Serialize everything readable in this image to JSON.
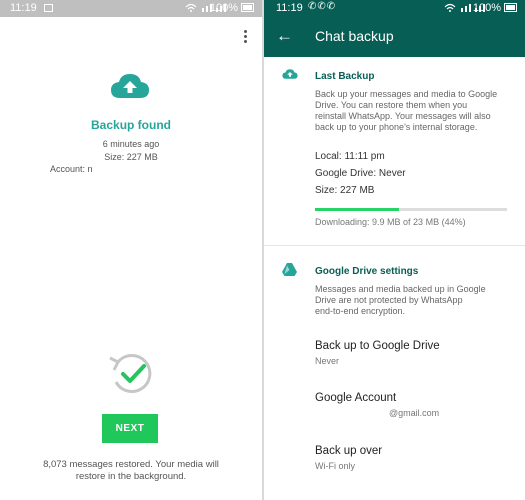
{
  "left_screen": {
    "status": {
      "time": "11:19",
      "battery": "100%"
    },
    "backup_found": "Backup found",
    "backup_age": "6 minutes ago",
    "backup_size": "Size: 227 MB",
    "account_label": "Account: n",
    "next_label": "NEXT",
    "restored_line1": "8,073 messages restored. Your media will",
    "restored_line2": "restore in the background."
  },
  "right_screen": {
    "status": {
      "time": "11:19",
      "battery": "100%"
    },
    "title": "Chat backup",
    "last_backup": {
      "heading": "Last Backup",
      "description": [
        "Back up your messages and media to Google",
        "Drive. You can restore them when you",
        "reinstall WhatsApp. Your messages will also",
        "back up to your phone's internal storage."
      ],
      "local": "Local: 11:11 pm",
      "google_drive": "Google Drive: Never",
      "size": "Size: 227 MB",
      "progress_fraction": 0.44,
      "downloading": "Downloading: 9.9 MB of 23 MB (44%)"
    },
    "drive_settings": {
      "heading": "Google Drive settings",
      "description": [
        "Messages and media backed up in Google",
        "Drive are not protected by WhatsApp",
        "end-to-end encryption."
      ]
    },
    "settings": [
      {
        "title": "Back up to Google Drive",
        "value": "Never"
      },
      {
        "title": "Google Account",
        "value": "@gmail.com"
      },
      {
        "title": "Back up over",
        "value": "Wi-Fi only"
      }
    ]
  },
  "colors": {
    "teal_dark": "#075e54",
    "teal_accent": "#26a69a",
    "green": "#25d366"
  }
}
